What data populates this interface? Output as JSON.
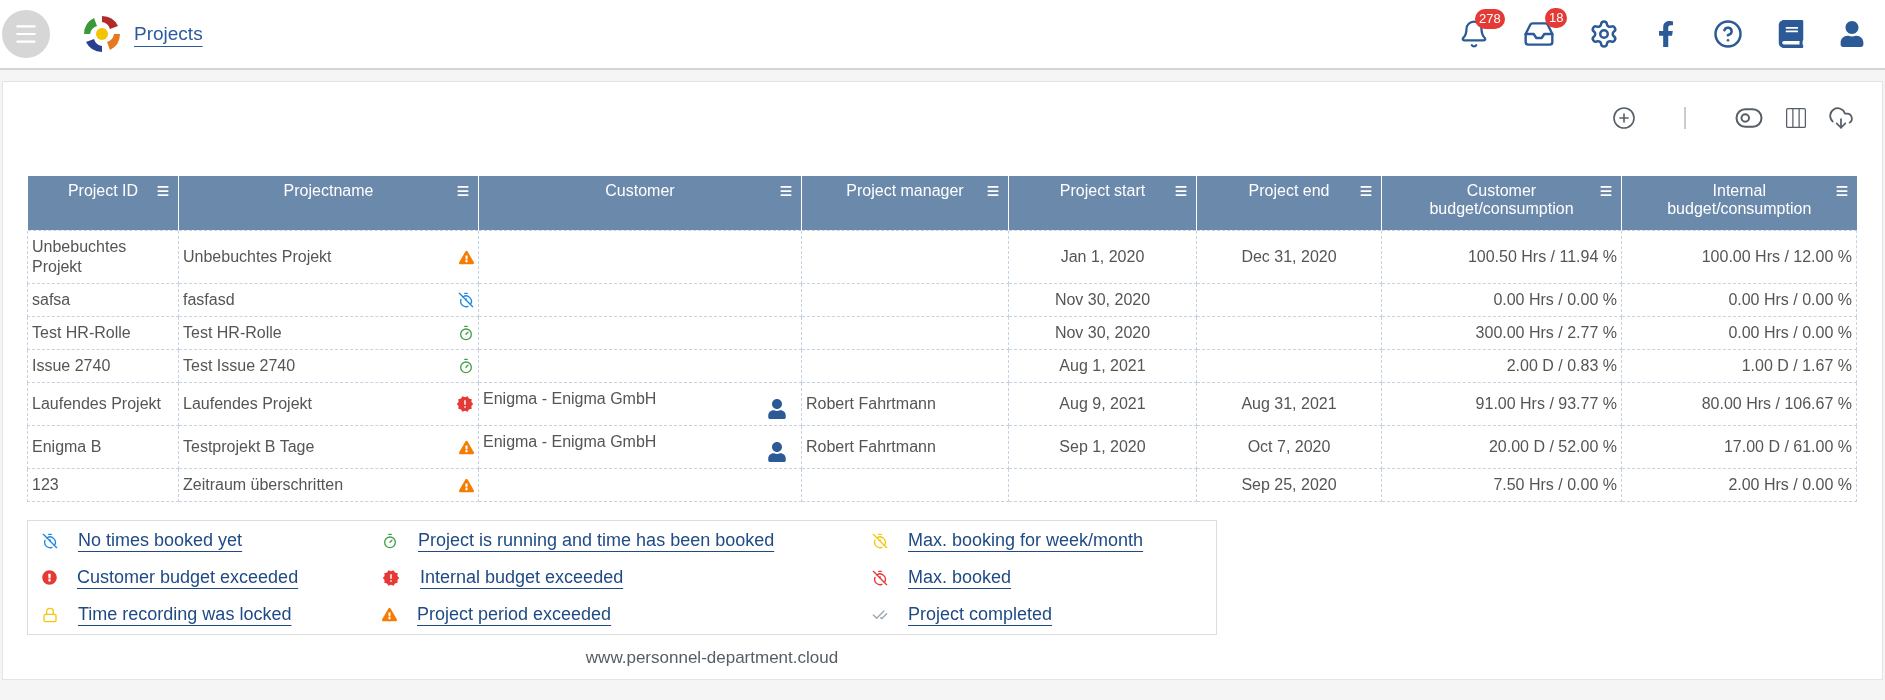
{
  "header": {
    "title": "Projects",
    "notifications_badge": "278",
    "inbox_badge": "18"
  },
  "table": {
    "columns": [
      {
        "label": "Project ID"
      },
      {
        "label": "Projectname"
      },
      {
        "label": "Customer"
      },
      {
        "label": "Project manager"
      },
      {
        "label": "Project start"
      },
      {
        "label": "Project end"
      },
      {
        "label": "Customer budget/consumption"
      },
      {
        "label": "Internal budget/consumption"
      }
    ],
    "rows": [
      {
        "id": "Unbebuchtes Projekt",
        "name": "Unbebuchtes Projekt",
        "kind": "period_exceeded",
        "start": "Jan 1, 2020",
        "end": "Dec 31, 2020",
        "customer_budget": "100.50 Hrs / 11.94 %",
        "internal_budget": "100.00 Hrs / 12.00 %"
      },
      {
        "id": "safsa",
        "name": "fasfasd",
        "kind": "no_times",
        "start": "Nov 30, 2020",
        "customer_budget": "0.00 Hrs / 0.00 %",
        "internal_budget": "0.00 Hrs / 0.00 %"
      },
      {
        "id": "Test HR-Rolle",
        "name": "Test HR-Rolle",
        "kind": "running",
        "start": "Nov 30, 2020",
        "customer_budget": "300.00 Hrs / 2.77 %",
        "internal_budget": "0.00 Hrs / 0.00 %"
      },
      {
        "id": "Issue 2740",
        "name": "Test Issue 2740",
        "kind": "running",
        "start": "Aug 1, 2021",
        "customer_budget": "2.00 D / 0.83 %",
        "internal_budget": "1.00 D / 1.67 %"
      },
      {
        "id": "Laufendes Projekt",
        "name": "Laufendes Projekt",
        "kind": "internal_exceeded",
        "customer": "Enigma - Enigma GmbH",
        "manager": "Robert Fahrtmann",
        "start": "Aug 9, 2021",
        "end": "Aug 31, 2021",
        "customer_budget": "91.00 Hrs / 93.77 %",
        "internal_budget": "80.00 Hrs / 106.67 %"
      },
      {
        "id": "Enigma B",
        "name": "Testprojekt B Tage",
        "kind": "period_exceeded",
        "customer": "Enigma - Enigma GmbH",
        "manager": "Robert Fahrtmann",
        "start": "Sep 1, 2020",
        "end": "Oct 7, 2020",
        "customer_budget": "20.00 D / 52.00 %",
        "internal_budget": "17.00 D / 61.00 %"
      },
      {
        "id": "123",
        "name": "Zeitraum überschritten",
        "kind": "period_exceeded",
        "end": "Sep 25, 2020",
        "customer_budget": "7.50 Hrs / 0.00 %",
        "internal_budget": "2.00 Hrs / 0.00 %"
      }
    ]
  },
  "legend": [
    {
      "kind": "no_times",
      "label": "No times booked yet"
    },
    {
      "kind": "running",
      "label": "Project is running and time has been booked"
    },
    {
      "kind": "max_week_month",
      "label": "Max. booking for week/month"
    },
    {
      "kind": "customer_exceeded",
      "label": "Customer budget exceeded"
    },
    {
      "kind": "internal_exceeded",
      "label": "Internal budget exceeded"
    },
    {
      "kind": "max_booked",
      "label": "Max. booked"
    },
    {
      "kind": "locked",
      "label": "Time recording was locked"
    },
    {
      "kind": "period_exceeded",
      "label": "Project period exceeded"
    },
    {
      "kind": "completed",
      "label": "Project completed"
    }
  ],
  "footer": "www.personnel-department.cloud"
}
